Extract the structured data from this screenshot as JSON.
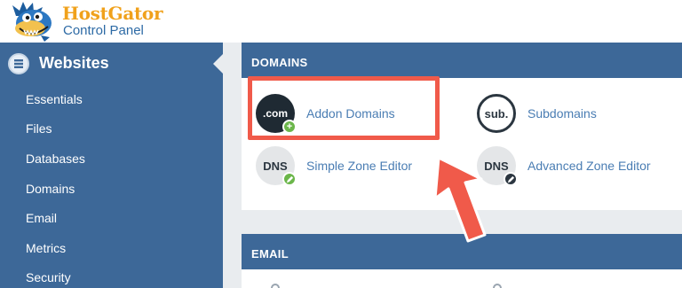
{
  "brand": {
    "name": "HostGator",
    "subtitle": "Control Panel"
  },
  "sidebar": {
    "section_title": "Websites",
    "items": [
      {
        "label": "Essentials"
      },
      {
        "label": "Files"
      },
      {
        "label": "Databases"
      },
      {
        "label": "Domains"
      },
      {
        "label": "Email"
      },
      {
        "label": "Metrics"
      },
      {
        "label": "Security"
      }
    ]
  },
  "domains_panel": {
    "title": "DOMAINS",
    "tools": [
      {
        "label": "Addon Domains",
        "icon_text": ".com",
        "icon": "dot-com-icon",
        "badge": "+"
      },
      {
        "label": "Subdomains",
        "icon_text": "sub.",
        "icon": "sub-icon"
      },
      {
        "label": "Simple Zone Editor",
        "icon_text": "DNS",
        "icon": "dns-icon"
      },
      {
        "label": "Advanced Zone Editor",
        "icon_text": "DNS",
        "icon": "dns-icon"
      }
    ]
  },
  "email_panel": {
    "title": "EMAIL"
  },
  "colors": {
    "sidebar": "#3d6898",
    "accent": "#f05a4a",
    "link": "#4a7db3",
    "brand_orange": "#f0a11b",
    "badge_green": "#6bb64a"
  }
}
